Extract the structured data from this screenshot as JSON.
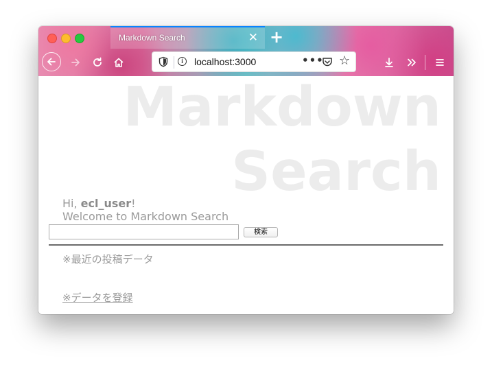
{
  "browser": {
    "tab_title": "Markdown Search",
    "tab_close": "✕",
    "new_tab": "+",
    "url": "localhost:3000",
    "url_more": "•••",
    "icons": {
      "back": "arrow-left-icon",
      "forward": "arrow-right-icon",
      "reload": "reload-icon",
      "home": "home-icon",
      "shield": "tracking-shield-icon",
      "info": "info-icon",
      "pocket": "pocket-icon",
      "star": "star-icon",
      "download": "download-icon",
      "overflow": "chevron-double-right-icon",
      "menu": "hamburger-menu-icon"
    },
    "accent_color": "#0a84ff"
  },
  "page": {
    "background_title": [
      "Markdown",
      "Search"
    ],
    "greeting_prefix": "Hi, ",
    "username": "ecl_user",
    "greeting_suffix": "!",
    "welcome": "Welcome to Markdown Search",
    "search": {
      "value": "",
      "button_label": "検索"
    },
    "recent_label": "※最近の投稿データ",
    "register_link": "※データを登録"
  }
}
